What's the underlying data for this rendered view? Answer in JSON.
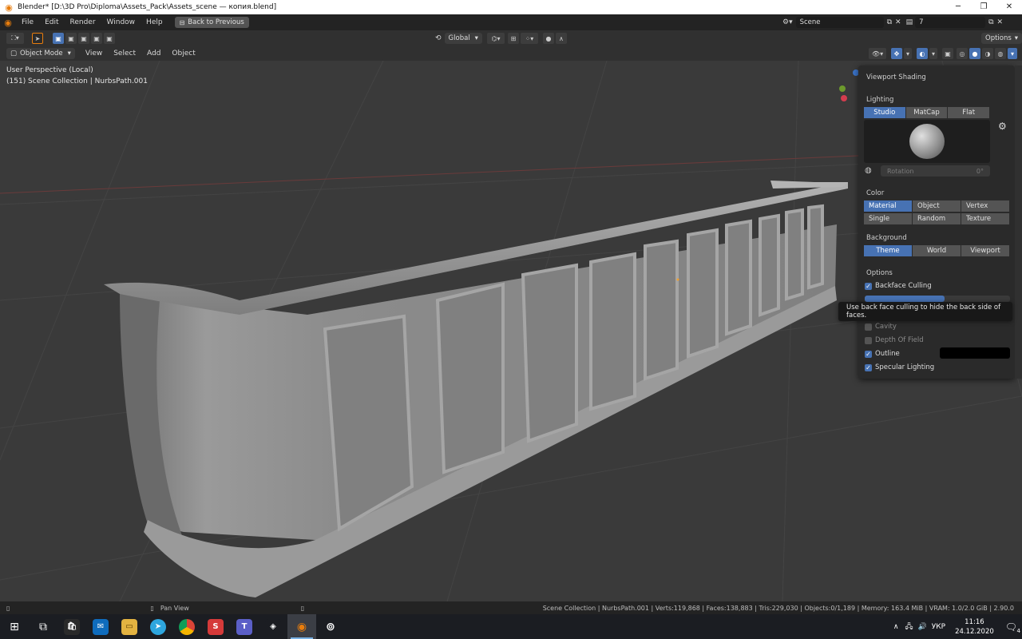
{
  "window": {
    "title": "Blender* [D:\\3D Pro\\Diploma\\Assets_Pack\\Assets_scene — копия.blend]"
  },
  "menu": {
    "items": [
      "File",
      "Edit",
      "Render",
      "Window",
      "Help"
    ],
    "back_button": "Back to Previous",
    "scene_label": "Scene",
    "view_layer_value": "7"
  },
  "toolbar": {
    "transform_orientation": "Global",
    "options_label": "Options"
  },
  "header": {
    "mode": "Object Mode",
    "menus": [
      "View",
      "Select",
      "Add",
      "Object"
    ]
  },
  "viewport": {
    "perspective": "User Perspective (Local)",
    "collection_info": "(151) Scene Collection | NurbsPath.001"
  },
  "shading": {
    "title": "Viewport Shading",
    "lighting_label": "Lighting",
    "lighting_modes": [
      "Studio",
      "MatCap",
      "Flat"
    ],
    "lighting_active": "Studio",
    "rotation_label": "Rotation",
    "rotation_value": "0°",
    "color_label": "Color",
    "color_modes": [
      "Material",
      "Object",
      "Vertex",
      "Single",
      "Random",
      "Texture"
    ],
    "color_active": "Material",
    "background_label": "Background",
    "background_modes": [
      "Theme",
      "World",
      "Viewport"
    ],
    "background_active": "Theme",
    "options_label": "Options",
    "options": [
      {
        "label": "Backface Culling",
        "checked": true
      },
      {
        "label": "Cavity",
        "checked": false
      },
      {
        "label": "Depth Of Field",
        "checked": false
      },
      {
        "label": "Outline",
        "checked": true
      },
      {
        "label": "Specular Lighting",
        "checked": true
      }
    ],
    "outline_color": "#000000",
    "tooltip": "Use back face culling to hide the back side of faces."
  },
  "statusbar": {
    "action": "Pan View",
    "stats": "Scene Collection | NurbsPath.001 | Verts:119,868 | Faces:138,883 | Tris:229,030 | Objects:0/1,189 | Memory: 163.4 MiB | VRAM: 1.0/2.0 GiB | 2.90.0"
  },
  "taskbar": {
    "lang": "УКР",
    "time": "11:16",
    "date": "24.12.2020",
    "notification_count": "4"
  },
  "colors": {
    "accent": "#4772b3",
    "viewport_bg": "#3a3a3a",
    "panel_bg": "#2a2a2a"
  }
}
